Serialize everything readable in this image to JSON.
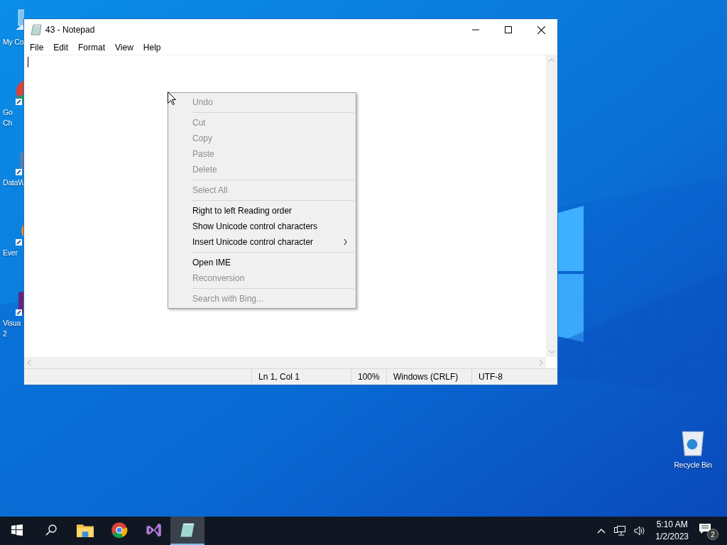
{
  "desktop_icons": [
    {
      "kind": "computer",
      "lines": [
        "My Co"
      ]
    },
    {
      "kind": "browser",
      "lines": [
        "Go",
        "Ch"
      ]
    },
    {
      "kind": "grid",
      "lines": [
        "DataW"
      ]
    },
    {
      "kind": "note",
      "lines": [
        "Ever"
      ]
    },
    {
      "kind": "studio",
      "lines": [
        "Visua",
        "2"
      ]
    },
    {
      "kind": "bin",
      "lines": [
        "Recycle Bin"
      ]
    }
  ],
  "window": {
    "title": "43 - Notepad",
    "menu": [
      "File",
      "Edit",
      "Format",
      "View",
      "Help"
    ]
  },
  "context_menu": [
    {
      "kind": "item",
      "label": "Undo",
      "disabled": true
    },
    {
      "kind": "separator"
    },
    {
      "kind": "item",
      "label": "Cut",
      "disabled": true
    },
    {
      "kind": "item",
      "label": "Copy",
      "disabled": true
    },
    {
      "kind": "item",
      "label": "Paste",
      "disabled": true
    },
    {
      "kind": "item",
      "label": "Delete",
      "disabled": true
    },
    {
      "kind": "separator"
    },
    {
      "kind": "item",
      "label": "Select All",
      "disabled": true
    },
    {
      "kind": "separator"
    },
    {
      "kind": "item",
      "label": "Right to left Reading order",
      "disabled": false
    },
    {
      "kind": "item",
      "label": "Show Unicode control characters",
      "disabled": false
    },
    {
      "kind": "item",
      "label": "Insert Unicode control character",
      "disabled": false,
      "submenu": true
    },
    {
      "kind": "separator"
    },
    {
      "kind": "item",
      "label": "Open IME",
      "disabled": false
    },
    {
      "kind": "item",
      "label": "Reconversion",
      "disabled": true
    },
    {
      "kind": "separator"
    },
    {
      "kind": "item",
      "label": "Search with Bing...",
      "disabled": true
    }
  ],
  "status_bar": [
    "Ln 1, Col 1",
    "100%",
    "Windows (CRLF)",
    "UTF-8"
  ],
  "taskbar": {
    "apps": [
      {
        "kind": "start",
        "selected": false
      },
      {
        "kind": "search",
        "selected": false
      },
      {
        "kind": "folder",
        "selected": false
      },
      {
        "kind": "browser",
        "selected": false
      },
      {
        "kind": "studio",
        "selected": false
      },
      {
        "kind": "notepad",
        "selected": true
      }
    ],
    "time": "5:10 AM",
    "date": "1/2/2023",
    "notifications": "2"
  }
}
